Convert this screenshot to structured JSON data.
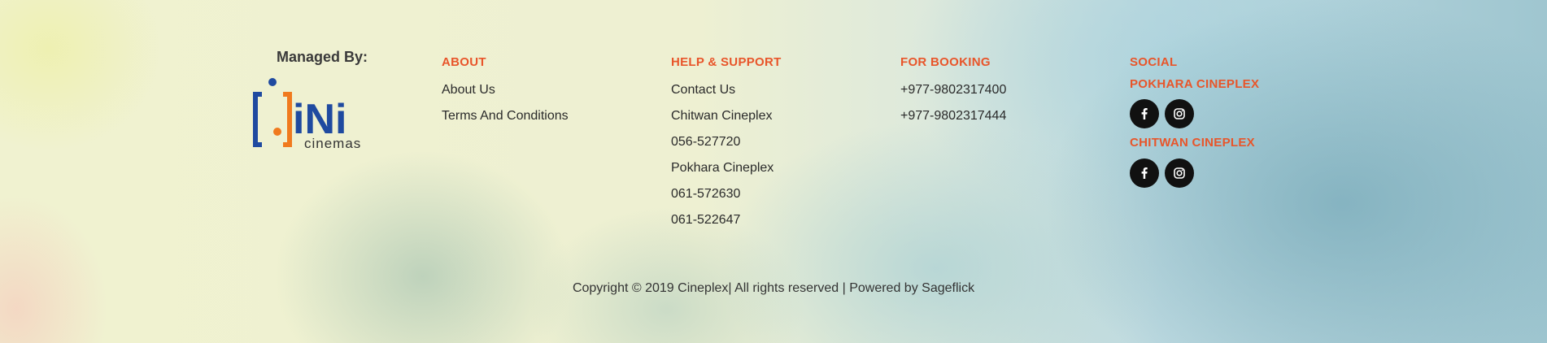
{
  "managed": {
    "title": "Managed By:",
    "logo_text_main": "iNi",
    "logo_text_sub": "cinemas"
  },
  "about": {
    "heading": "ABOUT",
    "items": [
      "About Us",
      "Terms And Conditions"
    ]
  },
  "help": {
    "heading": "HELP & SUPPORT",
    "items": [
      "Contact Us",
      "Chitwan Cineplex",
      "056-527720",
      "Pokhara Cineplex",
      "061-572630",
      "061-522647"
    ]
  },
  "booking": {
    "heading": "FOR BOOKING",
    "items": [
      "+977-9802317400",
      "+977-9802317444"
    ]
  },
  "social": {
    "heading": "SOCIAL",
    "groups": [
      {
        "label": "POKHARA CINEPLEX",
        "icons": [
          "facebook-icon",
          "instagram-icon"
        ]
      },
      {
        "label": "CHITWAN CINEPLEX",
        "icons": [
          "facebook-icon",
          "instagram-icon"
        ]
      }
    ]
  },
  "footer": {
    "copyright": "Copyright © 2019 Cineplex| All rights reserved | Powered by Sageflick"
  },
  "colors": {
    "accent": "#e8552a",
    "logo_blue": "#1f4aa0",
    "logo_orange": "#f07a1e"
  }
}
